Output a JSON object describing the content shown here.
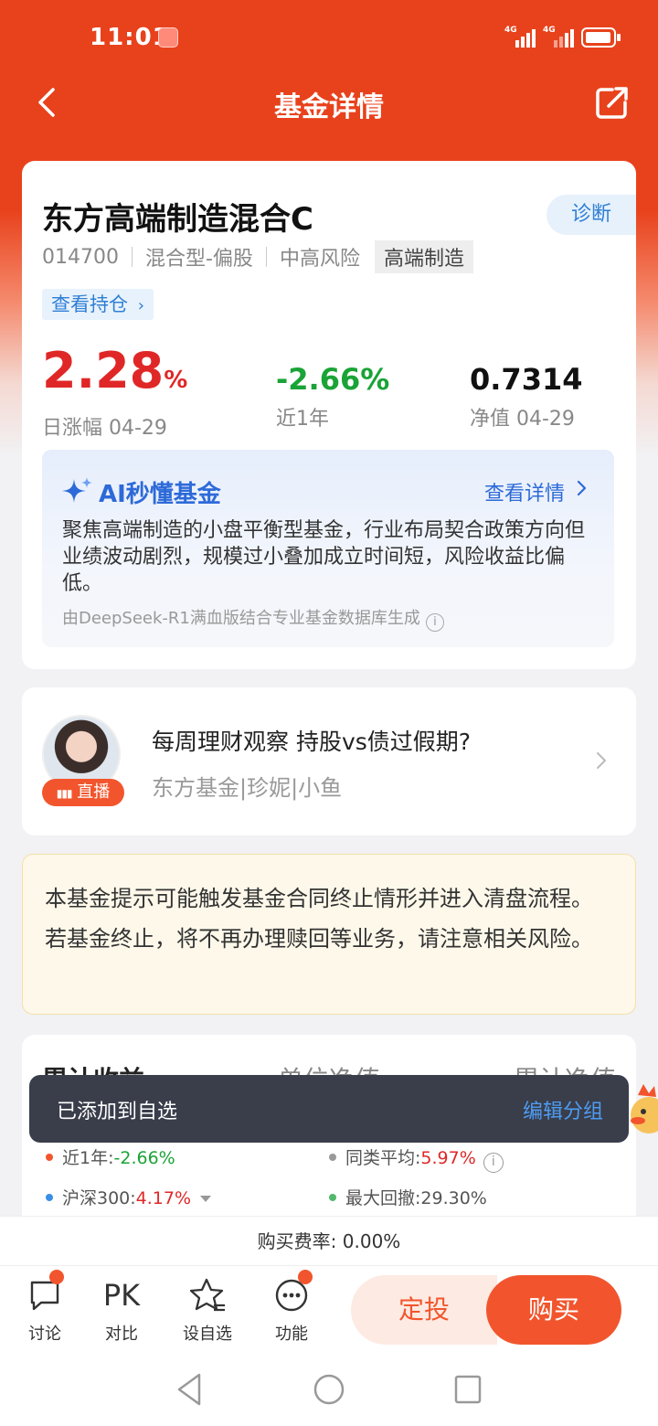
{
  "status_bar": {
    "time": "11:01",
    "sim1": "4G",
    "sim2": "4G",
    "battery_level": 0.85
  },
  "nav": {
    "title": "基金详情",
    "back_icon": "chevron-left-icon",
    "share_icon": "share-icon"
  },
  "fund": {
    "name": "东方高端制造混合C",
    "diagnose_label": "诊断",
    "code": "014700",
    "type": "混合型-偏股",
    "risk": "中高风险",
    "theme": "高端制造",
    "holdings_label": "查看持仓",
    "daily_change": "2.28",
    "daily_change_unit": "%",
    "daily_change_label": "日涨幅 04-29",
    "year_change": "-2.66%",
    "year_change_label": "近1年",
    "nav": "0.7314",
    "nav_label": "净值 04-29"
  },
  "ai": {
    "title": "AI秒懂基金",
    "more_label": "查看详情",
    "summary": "聚焦高端制造的小盘平衡型基金，行业布局契合政策方向但业绩波动剧烈，规模过小叠加成立时间短，风险收益比偏低。",
    "source": "由DeepSeek-R1满血版结合专业基金数据库生成"
  },
  "live": {
    "badge": "直播",
    "title": "每周理财观察 持股vs债过假期?",
    "subtitle": "东方基金|珍妮|小鱼"
  },
  "notice": {
    "text": "本基金提示可能触发基金合同终止情形并进入清盘流程。若基金终止，将不再办理赎回等业务，请注意相关风险。"
  },
  "performance": {
    "tabs": [
      "累计收益",
      "单位净值",
      "累计净值"
    ],
    "stats": {
      "year_label": "近1年:",
      "year_value": "-2.66%",
      "peer_label": "同类平均:",
      "peer_value": "5.97%",
      "index_label": "沪深300:",
      "index_value": "4.17%",
      "drawdown_label": "最大回撤:",
      "drawdown_value": "29.30%"
    },
    "colors": {
      "fund": "#f2552d",
      "peer": "#999999",
      "index": "#3a8ee6",
      "drawdown": "#52b86a"
    }
  },
  "toast": {
    "text": "已添加到自选",
    "action": "编辑分组"
  },
  "fee": {
    "text": "购买费率: 0.00%"
  },
  "actions": {
    "discuss": "讨论",
    "compare_icon_text": "PK",
    "compare": "对比",
    "watchlist": "设自选",
    "functions": "功能",
    "regular_invest": "定投",
    "buy": "购买"
  },
  "theme": {
    "brand": "#e8421c",
    "up": "#e02727",
    "down": "#1aa336",
    "link": "#2d6ad8"
  }
}
